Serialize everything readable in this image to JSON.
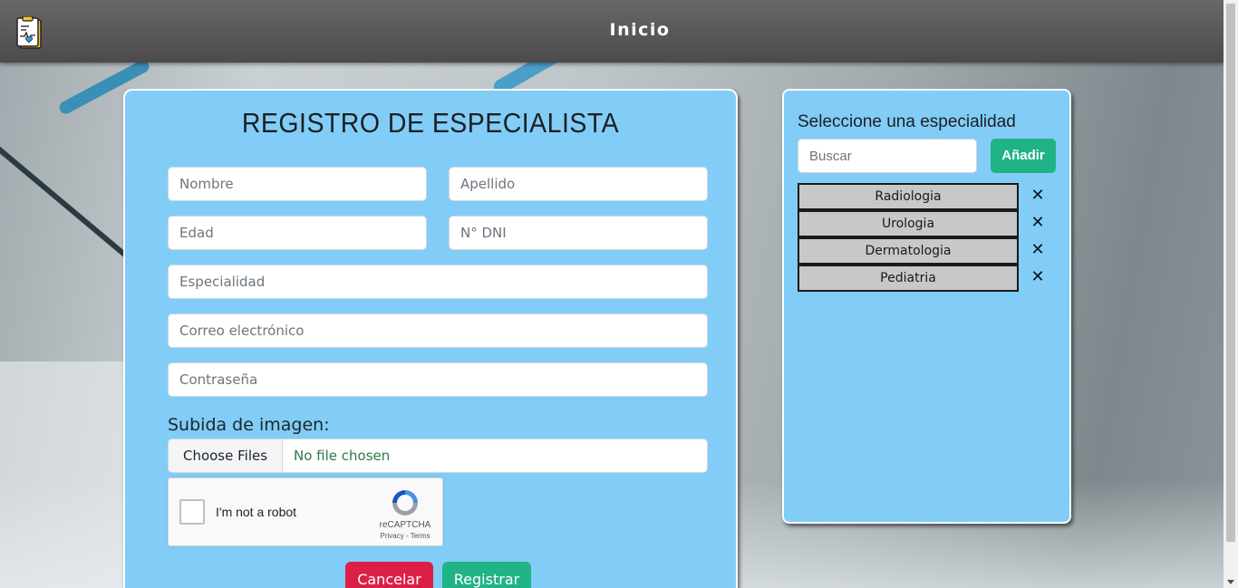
{
  "nav": {
    "title": "Inicio"
  },
  "form": {
    "title": "REGISTRO DE ESPECIALISTA",
    "fields": {
      "nombre": "Nombre",
      "apellido": "Apellido",
      "edad": "Edad",
      "dni": "N° DNI",
      "especialidad": "Especialidad",
      "correo": "Correo electrónico",
      "contrasena": "Contraseña"
    },
    "upload_label": "Subida de imagen:",
    "file_button": "Choose Files",
    "file_status": "No file chosen",
    "captcha": {
      "label": "I'm not a robot",
      "brand": "reCAPTCHA",
      "links": "Privacy - Terms"
    },
    "cancel_label": "Cancelar",
    "register_label": "Registrar"
  },
  "specialties": {
    "title": "Seleccione una especialidad",
    "search_placeholder": "Buscar",
    "add_label": "Añadir",
    "remove_symbol": "✕",
    "items": [
      "Radiologia",
      "Urologia",
      "Dermatologia",
      "Pediatria"
    ]
  },
  "colors": {
    "card_bg": "#81cdf8",
    "cancel": "#dc1f47",
    "register": "#20b386"
  }
}
